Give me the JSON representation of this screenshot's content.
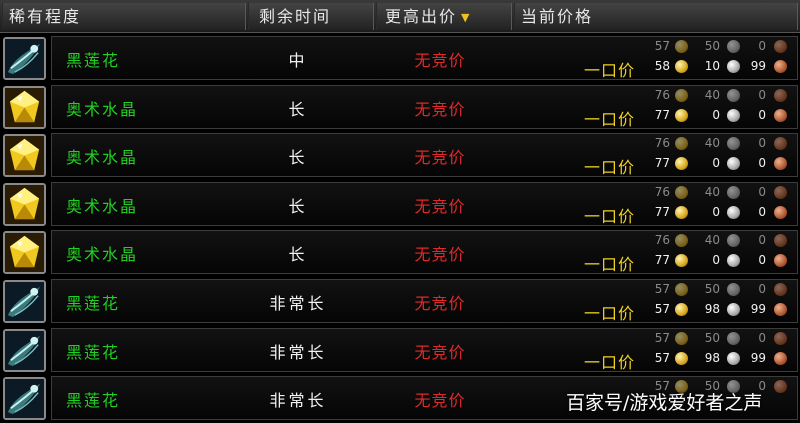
{
  "header": {
    "col_rarity": "稀有程度",
    "col_time": "剩余时间",
    "col_bid": "更高出价",
    "col_price": "当前价格",
    "sort_icon": "sort-down-arrow"
  },
  "colors": {
    "item_name": "#22d022",
    "no_bid": "#e02a2a",
    "buyout": "#f0d020",
    "gold": "#d8a820",
    "silver": "#aaaaaa",
    "copper": "#b05a30"
  },
  "rows": [
    {
      "icon": "black-lotus-icon",
      "name": "黑莲花",
      "time": "中",
      "bid": "无竞价",
      "buyout_label": "一口价",
      "bid_price": {
        "g": "57",
        "s": "50",
        "c": "0"
      },
      "buyout": {
        "g": "58",
        "s": "10",
        "c": "99"
      }
    },
    {
      "icon": "arcanite-crystal-icon",
      "name": "奥术水晶",
      "time": "长",
      "bid": "无竞价",
      "buyout_label": "一口价",
      "bid_price": {
        "g": "76",
        "s": "40",
        "c": "0"
      },
      "buyout": {
        "g": "77",
        "s": "0",
        "c": "0"
      }
    },
    {
      "icon": "arcanite-crystal-icon",
      "name": "奥术水晶",
      "time": "长",
      "bid": "无竞价",
      "buyout_label": "一口价",
      "bid_price": {
        "g": "76",
        "s": "40",
        "c": "0"
      },
      "buyout": {
        "g": "77",
        "s": "0",
        "c": "0"
      }
    },
    {
      "icon": "arcanite-crystal-icon",
      "name": "奥术水晶",
      "time": "长",
      "bid": "无竞价",
      "buyout_label": "一口价",
      "bid_price": {
        "g": "76",
        "s": "40",
        "c": "0"
      },
      "buyout": {
        "g": "77",
        "s": "0",
        "c": "0"
      }
    },
    {
      "icon": "arcanite-crystal-icon",
      "name": "奥术水晶",
      "time": "长",
      "bid": "无竞价",
      "buyout_label": "一口价",
      "bid_price": {
        "g": "76",
        "s": "40",
        "c": "0"
      },
      "buyout": {
        "g": "77",
        "s": "0",
        "c": "0"
      }
    },
    {
      "icon": "black-lotus-icon",
      "name": "黑莲花",
      "time": "非常长",
      "bid": "无竞价",
      "buyout_label": "一口价",
      "bid_price": {
        "g": "57",
        "s": "50",
        "c": "0"
      },
      "buyout": {
        "g": "57",
        "s": "98",
        "c": "99"
      }
    },
    {
      "icon": "black-lotus-icon",
      "name": "黑莲花",
      "time": "非常长",
      "bid": "无竞价",
      "buyout_label": "一口价",
      "bid_price": {
        "g": "57",
        "s": "50",
        "c": "0"
      },
      "buyout": {
        "g": "57",
        "s": "98",
        "c": "99"
      }
    },
    {
      "icon": "black-lotus-icon",
      "name": "黑莲花",
      "time": "非常长",
      "bid": "无竞价",
      "buyout_label": "",
      "bid_price": {
        "g": "57",
        "s": "50",
        "c": "0"
      },
      "buyout": {
        "g": "",
        "s": "",
        "c": ""
      }
    }
  ],
  "watermark": "百家号/游戏爱好者之声"
}
